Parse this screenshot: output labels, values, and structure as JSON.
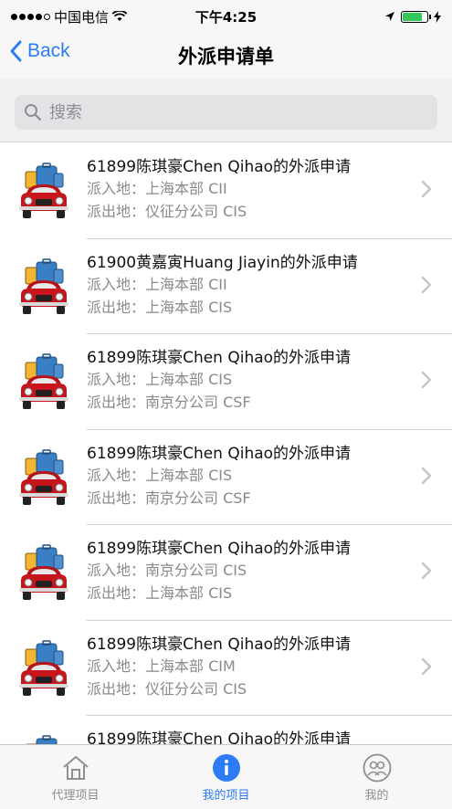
{
  "status_bar": {
    "carrier": "中国电信",
    "time": "下午4:25",
    "battery_color": "#35c759"
  },
  "nav": {
    "back_label": "Back",
    "title": "外派申请单"
  },
  "search": {
    "placeholder": "搜索"
  },
  "list": {
    "in_label": "派入地：",
    "out_label": "派出地：",
    "items": [
      {
        "title": "61899陈琪豪Chen Qihao的外派申请",
        "in": "上海本部 CII",
        "out": "仪征分公司 CIS"
      },
      {
        "title": "61900黄嘉寅Huang Jiayin的外派申请",
        "in": "上海本部 CII",
        "out": "上海本部 CIS"
      },
      {
        "title": "61899陈琪豪Chen Qihao的外派申请",
        "in": "上海本部 CIS",
        "out": "南京分公司 CSF"
      },
      {
        "title": "61899陈琪豪Chen Qihao的外派申请",
        "in": "上海本部 CIS",
        "out": "南京分公司 CSF"
      },
      {
        "title": "61899陈琪豪Chen Qihao的外派申请",
        "in": "南京分公司 CIS",
        "out": "上海本部 CIS"
      },
      {
        "title": "61899陈琪豪Chen Qihao的外派申请",
        "in": "上海本部 CIM",
        "out": "仪征分公司 CIS"
      },
      {
        "title": "61899陈琪豪Chen Qihao的外派申请",
        "in": "",
        "out": ""
      }
    ]
  },
  "tabs": [
    {
      "label": "代理项目",
      "icon": "house-icon",
      "active": false
    },
    {
      "label": "我的项目",
      "icon": "info-icon",
      "active": true
    },
    {
      "label": "我的",
      "icon": "people-icon",
      "active": false
    }
  ],
  "colors": {
    "accent": "#2d7cf6",
    "car_body": "#c8151b",
    "luggage_blue": "#3a7fc4",
    "luggage_yellow": "#f2b632"
  }
}
